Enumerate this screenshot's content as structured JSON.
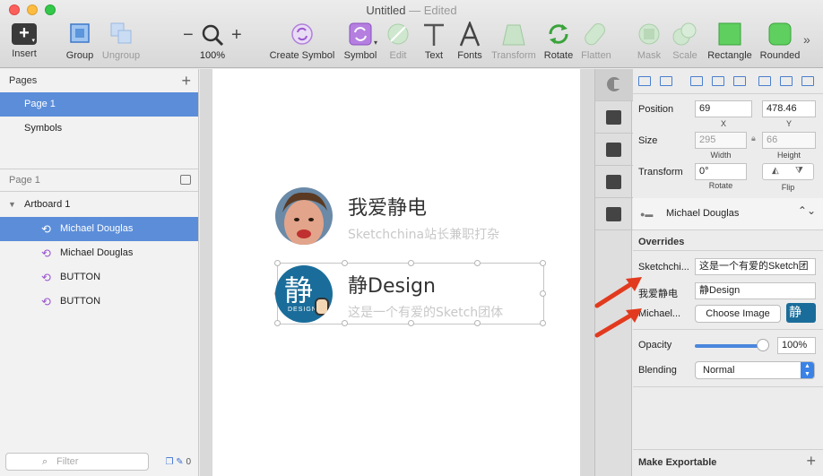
{
  "window": {
    "title": "Untitled",
    "title_suffix": "— Edited"
  },
  "toolbar": {
    "insert": "Insert",
    "group": "Group",
    "ungroup": "Ungroup",
    "zoom_minus": "−",
    "zoom_plus": "+",
    "zoom_level": "100%",
    "create_symbol": "Create Symbol",
    "symbol": "Symbol",
    "edit": "Edit",
    "text": "Text",
    "fonts": "Fonts",
    "transform": "Transform",
    "rotate": "Rotate",
    "flatten": "Flatten",
    "mask": "Mask",
    "scale": "Scale",
    "rectangle": "Rectangle",
    "rounded": "Rounded",
    "more": "»"
  },
  "sidebar": {
    "pages_header": "Pages",
    "add": "+",
    "pages": [
      "Page 1",
      "Symbols"
    ],
    "current_page": "Page 1",
    "layers": [
      {
        "name": "Artboard 1"
      },
      {
        "name": "Michael Douglas"
      },
      {
        "name": "Michael Douglas"
      },
      {
        "name": "BUTTON"
      },
      {
        "name": "BUTTON"
      }
    ],
    "filter_placeholder": "Filter",
    "badge": "0"
  },
  "canvas": {
    "item1": {
      "title": "我爱静电",
      "subtitle": "Sketchchina站长兼职打杂"
    },
    "item2": {
      "title": "静Design",
      "subtitle": "这是一个有爱的Sketch团体",
      "logo_char": "静",
      "logo_sub": "DESIGN"
    }
  },
  "inspector": {
    "position_label": "Position",
    "position_x": "69",
    "position_y": "478.46",
    "x_label": "X",
    "y_label": "Y",
    "size_label": "Size",
    "width": "295",
    "height": "66",
    "width_label": "Width",
    "height_label": "Height",
    "transform_label": "Transform",
    "rotate_value": "0°",
    "rotate_label": "Rotate",
    "flip_label": "Flip",
    "symbol_name": "Michael Douglas",
    "overrides_header": "Overrides",
    "override1_label": "Sketchchi...",
    "override1_value": "这是一个有爱的Sketch团",
    "override2_label": "我爱静电",
    "override2_value": "静Design",
    "override3_label": "Michael...",
    "choose_image": "Choose Image",
    "thumb_char": "静",
    "opacity_label": "Opacity",
    "opacity_value": "100%",
    "opacity_fraction": 1.0,
    "blending_label": "Blending",
    "blending_value": "Normal",
    "export_label": "Make Exportable",
    "export_add": "+"
  },
  "colors": {
    "accent": "#5b8dd9",
    "annotation": "#e23a1e",
    "symbol": "#9b59d0"
  }
}
